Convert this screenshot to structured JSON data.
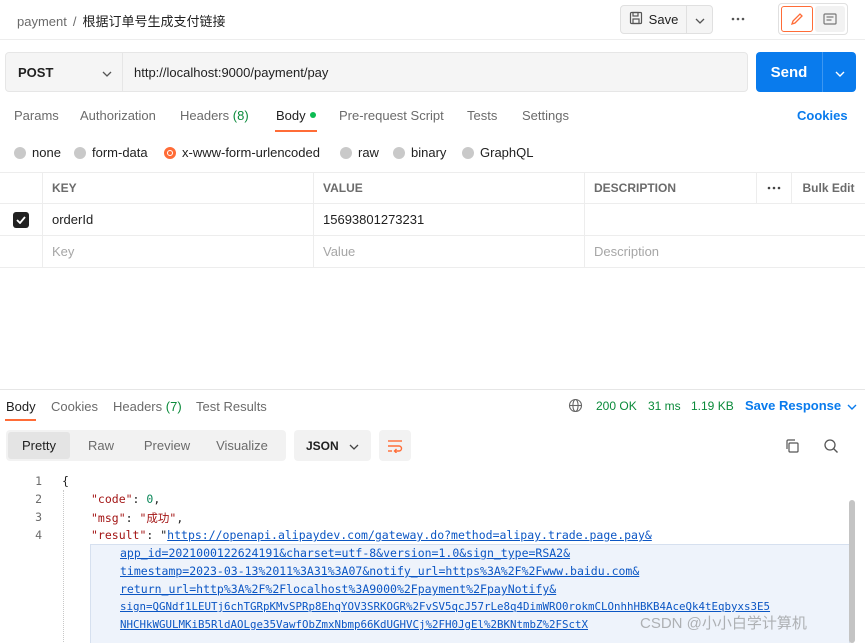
{
  "breadcrumb": {
    "collection": "payment",
    "separator": "/",
    "request": "根据订单号生成支付链接"
  },
  "toolbar": {
    "save_label": "Save"
  },
  "request": {
    "method": "POST",
    "url": "http://localhost:9000/payment/pay",
    "send_label": "Send"
  },
  "request_tabs": {
    "params": "Params",
    "authorization": "Authorization",
    "headers": "Headers",
    "headers_count": "(8)",
    "body": "Body",
    "pre_request": "Pre-request Script",
    "tests": "Tests",
    "settings": "Settings",
    "cookies": "Cookies"
  },
  "body_types": [
    "none",
    "form-data",
    "x-www-form-urlencoded",
    "raw",
    "binary",
    "GraphQL"
  ],
  "selected_body_type": "x-www-form-urlencoded",
  "params_table": {
    "headers": {
      "key": "KEY",
      "value": "VALUE",
      "description": "DESCRIPTION",
      "bulk_edit": "Bulk Edit"
    },
    "rows": [
      {
        "key": "orderId",
        "value": "15693801273231",
        "checked": true
      }
    ],
    "placeholder": {
      "key": "Key",
      "value": "Value",
      "description": "Description"
    }
  },
  "response_tabs": {
    "body": "Body",
    "cookies": "Cookies",
    "headers": "Headers",
    "headers_count": "(7)",
    "test_results": "Test Results"
  },
  "response_status": {
    "status": "200 OK",
    "time": "31 ms",
    "size": "1.19 KB",
    "save_response": "Save Response"
  },
  "view_modes": [
    "Pretty",
    "Raw",
    "Preview",
    "Visualize"
  ],
  "format": "JSON",
  "code_lines": {
    "l1": "{",
    "l2_key": "\"code\"",
    "l2_val": "0",
    "l3_key": "\"msg\"",
    "l3_val": "\"成功\"",
    "l4_key": "\"result\"",
    "l4_val": "https://openapi.alipaydev.com/gateway.do?method=alipay.trade.page.pay&",
    "l5": "app_id=2021000122624191&charset=utf-8&version=1.0&sign_type=RSA2&",
    "l6": "timestamp=2023-03-13%2011%3A31%3A07&notify_url=https%3A%2F%2Fwww.baidu.com&",
    "l7": "return_url=http%3A%2F%2Flocalhost%3A9000%2Fpayment%2FpayNotify&",
    "l8": "sign=QGNdf1LEUTj6chTGRpKMvSPRp8EhqYOV3SRKOGR%2FvSV5qcJ57rLe8q4DimWRO0rokmCLOnhhHBKB4AceQk4tEqbyxs3E5",
    "l9": "NHCHkWGULMKiB5RldAOLge35VawfObZmxNbmp66KdUGHVCj%2FH0JgEl%2BKNtmbZ%2FSctX"
  },
  "line_numbers": [
    "1",
    "2",
    "3",
    "4"
  ],
  "watermark": "CSDN @小小白学计算机"
}
